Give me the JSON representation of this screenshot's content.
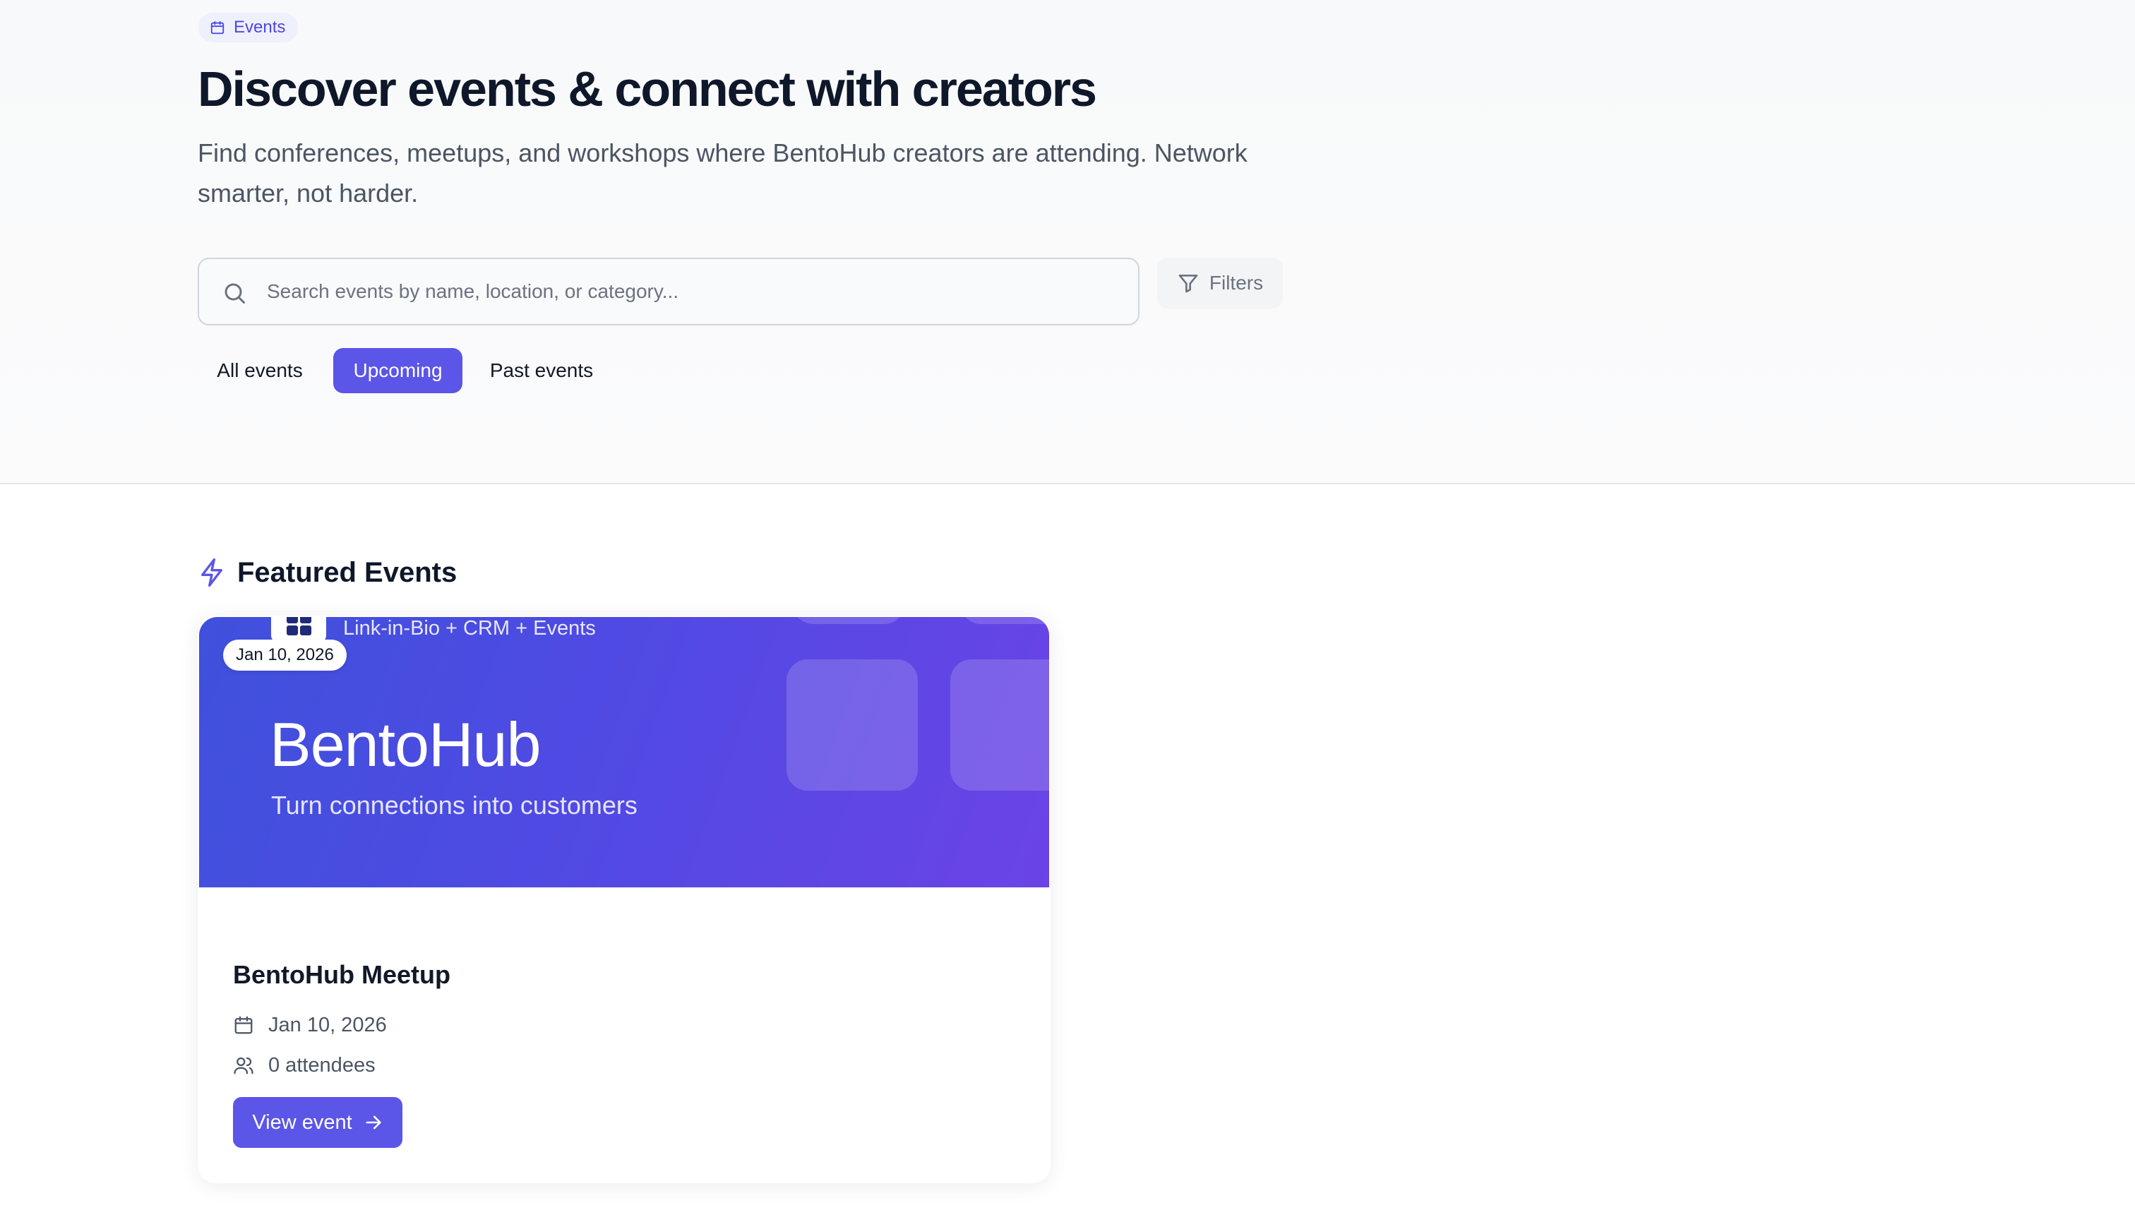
{
  "hero": {
    "badge": {
      "label": "Events",
      "icon": "calendar-icon"
    },
    "title": "Discover events & connect with creators",
    "subtitle": "Find conferences, meetups, and workshops where BentoHub creators are attending. Network smarter, not harder.",
    "search": {
      "placeholder": "Search events by name, location, or category...",
      "value": "",
      "icon": "search-icon"
    },
    "filters_label": "Filters",
    "tabs": [
      {
        "label": "All events",
        "active": false
      },
      {
        "label": "Upcoming",
        "active": true
      },
      {
        "label": "Past events",
        "active": false
      }
    ]
  },
  "featured": {
    "heading": "Featured Events",
    "icon": "lightning-icon",
    "events": [
      {
        "banner": {
          "tagline": "Link-in-Bio + CRM + Events",
          "brand": "BentoHub",
          "brand_subtitle": "Turn connections into customers"
        },
        "date_chip": "Jan 10, 2026",
        "title": "BentoHub Meetup",
        "date": "Jan 10, 2026",
        "attendees": "0 attendees",
        "cta": "View event"
      }
    ]
  },
  "colors": {
    "accent": "#5b55e8",
    "badge_bg": "#eef0fb",
    "banner_start": "#3f51dc",
    "banner_end": "#6b43e6",
    "heading": "#0f172a",
    "muted_text": "#4b5563"
  }
}
